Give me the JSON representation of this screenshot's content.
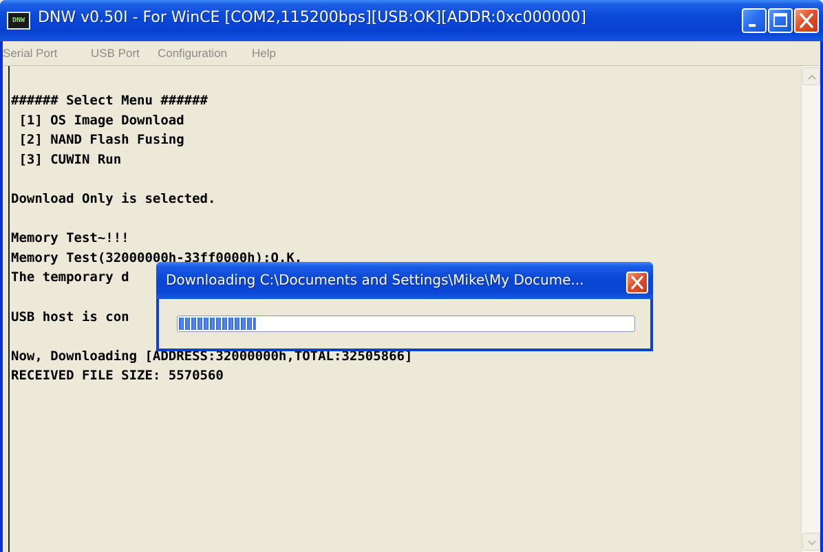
{
  "window": {
    "icon_text": "DNW",
    "title": "DNW v0.50I - For WinCE   [COM2,115200bps][USB:OK][ADDR:0xc000000]"
  },
  "menu": [
    "Serial Port",
    "USB Port",
    "Configuration",
    "Help"
  ],
  "console": {
    "lines": [
      "###### Select Menu ######",
      " [1] OS Image Download",
      " [2] NAND Flash Fusing",
      " [3] CUWIN Run",
      "",
      "Download Only is selected.",
      "",
      "Memory Test~!!!",
      "Memory Test(32000000h-33ff0000h):O.K.",
      "The temporary d",
      "",
      "USB host is con",
      "",
      "Now, Downloading [ADDRESS:32000000h,TOTAL:32505866]",
      "RECEIVED FILE SIZE: 5570560"
    ]
  },
  "dialog": {
    "title": "Downloading C:\\Documents and Settings\\Mike\\My Docume...",
    "progress_fraction": 0.17
  },
  "colors": {
    "titlebar": "#0a48d8",
    "close_button": "#e0522d",
    "window_bg": "#ece9d8",
    "progress": "#2f62d9"
  }
}
